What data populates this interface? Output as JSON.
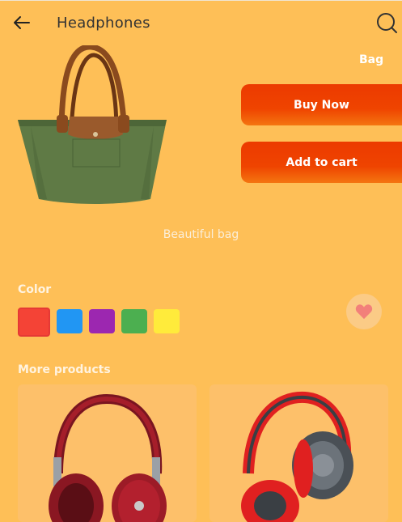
{
  "header": {
    "title": "Headphones",
    "back_icon": "arrow-left-icon",
    "search_icon": "search-icon"
  },
  "product": {
    "category": "Bag",
    "image": "tote-bag-image",
    "caption": "Beautiful bag"
  },
  "actions": {
    "buy_now": "Buy Now",
    "add_to_cart": "Add to cart"
  },
  "colors": {
    "label": "Color",
    "selected": "#F44336",
    "options": [
      "#F44336",
      "#2196F3",
      "#9C27B0",
      "#4CAF50",
      "#FFEB3B"
    ]
  },
  "favorite_icon": "heart-icon",
  "more_products": {
    "label": "More products",
    "items": [
      {
        "image": "red-headphones-image"
      },
      {
        "image": "red-grey-headphones-image"
      }
    ]
  },
  "theme": {
    "background": "#FEBF57",
    "accent": "#EF4400"
  }
}
